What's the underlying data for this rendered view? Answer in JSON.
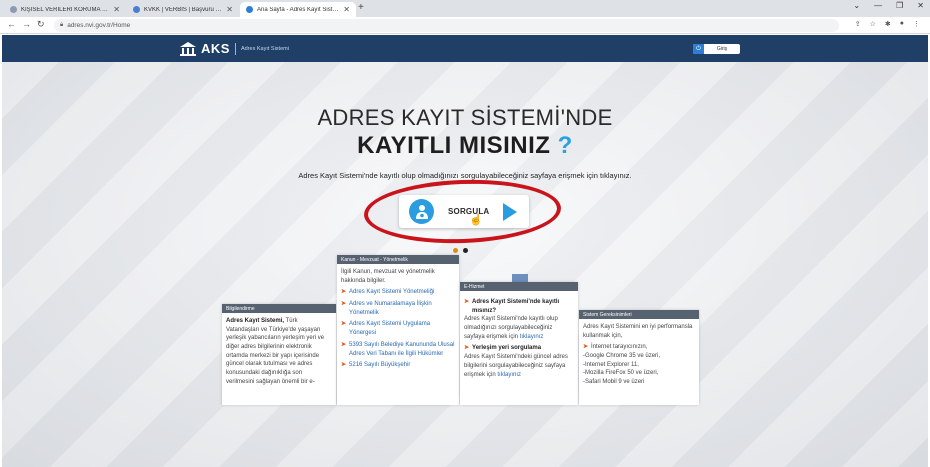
{
  "browser": {
    "tabs": [
      {
        "title": "KİŞİSEL VERİLERİ KORUMA KURU",
        "active": false
      },
      {
        "title": "KVKK | VERBİS | Başvuru Formu",
        "active": false
      },
      {
        "title": "Ana Sayfa - Adres Kayıt Sistemi",
        "active": true
      }
    ],
    "new_tab": "+",
    "url": "adres.nvi.gov.tr/Home"
  },
  "header": {
    "logo_text": "AKS",
    "logo_subtitle": "Adres Kayıt Sistemi",
    "login_label": "Giriş"
  },
  "hero": {
    "title_line1": "ADRES KAYIT SİSTEMİ'NDE",
    "title_line2": "KAYITLI MISINIZ",
    "question_mark": "?",
    "description": "Adres Kayıt Sistemi'nde kayıtlı olup olmadığınızı sorgulayabileceğiniz sayfaya erişmek için tıklayınız.",
    "button_label": "SORGULA"
  },
  "panels": {
    "bilgilendirme": {
      "header": "Bilgilendirme",
      "text_bold": "Adres Kayıt Sistemi,",
      "text": "Türk Vatandaşları ve Türkiye'de yaşayan yerleşik yabancıların yerleşim yeri ve diğer adres bilgilerinin elektronik ortamda merkezi bir yapı içerisinde güncel olarak tutulması ve adres konusundaki dağınıklığa son verilmesini sağlayan önemli bir e-"
    },
    "kanun": {
      "header": "Kanun - Mevzuat - Yönetmelik",
      "intro": "İlgili Kanun, mevzuat ve yönetmelik hakkında bilgiler.",
      "items": [
        "Adres Kayıt Sistemi Yönetmeliği",
        "Adres ve Numaralamaya İlişkin Yönetmelik",
        "Adres Kayıt Sistemi Uygulama Yönergesi",
        "5393 Sayılı Belediye Kanununda Ulusal Adres Veri Tabanı ile İlgili Hükümler",
        "5216 Sayılı Büyükşehir"
      ]
    },
    "ehizmet": {
      "header": "E-Hizmet",
      "q1": "Adres Kayıt Sistemi'nde kayıtlı mısınız?",
      "q1_text": "Adres Kayıt Sistemi'nde kayıtlı olup olmadığınızı sorgulayabileceğiniz sayfaya erişmek için",
      "link": "tıklayınız",
      "q2": "Yerleşim yeri sorgulama",
      "q2_text": "Adres Kayıt Sistemi'ndeki güncel adres bilgilerini sorgulayabileceğiniz sayfaya erişmek için"
    },
    "sistem": {
      "header": "Sistem Gereksinimleri",
      "intro": "Adres Kayıt Sistemini en iyi performansla kullanmak için,",
      "items": [
        "İnternet tarayıcınızın,",
        "-Google Chrome 35 ve üzeri,",
        "-Internet Explorer 11,",
        "-Mozilla FireFox 50 ve üzeri,",
        "-Safari Mobil 9 ve üzeri"
      ]
    }
  },
  "colors": {
    "header_bg": "#1f3f66",
    "accent_blue": "#2a9de0",
    "highlight_ring": "#c8141a",
    "arrow_orange": "#e0591c"
  }
}
